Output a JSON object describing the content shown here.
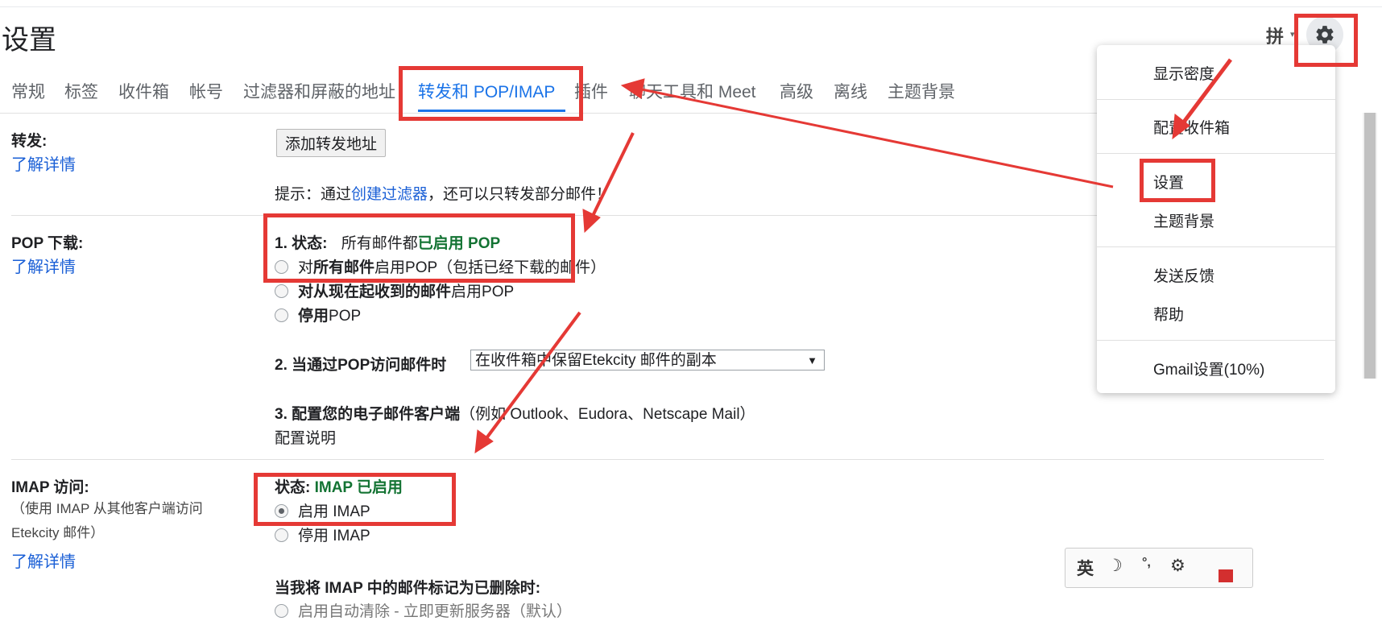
{
  "page": {
    "title": "设置"
  },
  "header": {
    "ime_label": "拼",
    "ime_caret": "▾"
  },
  "tabs": [
    {
      "label": "常规"
    },
    {
      "label": "标签"
    },
    {
      "label": "收件箱"
    },
    {
      "label": "帐号"
    },
    {
      "label": "过滤器和屏蔽的地址"
    },
    {
      "label": "转发和 POP/IMAP",
      "active": true
    },
    {
      "label": "插件"
    },
    {
      "label": "聊天工具和 Meet"
    },
    {
      "label": "高级"
    },
    {
      "label": "离线"
    },
    {
      "label": "主题背景"
    }
  ],
  "forwarding": {
    "label": "转发:",
    "learn_more": "了解详情",
    "add_button": "添加转发地址",
    "tip_prefix": "提示：通过",
    "tip_link": "创建过滤器",
    "tip_suffix": "，还可以只转发部分邮件！"
  },
  "pop": {
    "label": "POP 下载:",
    "learn_more": "了解详情",
    "status_label": "1. 状态:",
    "status_text": "所有邮件都",
    "status_value": "已启用 POP",
    "options": [
      {
        "prefix": "对",
        "bold": "所有邮件",
        "suffix": "启用POP（包括已经下载的邮件）"
      },
      {
        "prefix": "",
        "bold": "对从现在起收到的邮件",
        "suffix": "启用POP"
      },
      {
        "prefix": "",
        "bold": "停用",
        "suffix": "POP"
      }
    ],
    "when_access_label": "2. 当通过POP访问邮件时",
    "when_access_value": "在收件箱中保留Etekcity 邮件的副本",
    "configure_label": "3. 配置您的电子邮件客户端",
    "configure_hint": "（例如 Outlook、Eudora、Netscape Mail）",
    "configure_link": "配置说明"
  },
  "imap": {
    "label": "IMAP 访问:",
    "desc": "（使用 IMAP 从其他客户端访问 Etekcity 邮件）",
    "learn_more": "了解详情",
    "status_label": "状态:",
    "status_value": "IMAP 已启用",
    "options": [
      {
        "label": "启用 IMAP",
        "checked": true
      },
      {
        "label": "停用 IMAP",
        "checked": false
      }
    ],
    "delete_label": "当我将 IMAP 中的邮件标记为已删除时:",
    "delete_option_cutoff": "启用自动清除 - 立即更新服务器（默认）"
  },
  "settings_menu": {
    "items": [
      "显示密度",
      "配置收件箱",
      "设置",
      "主题背景",
      "发送反馈",
      "帮助",
      "Gmail设置(10%)"
    ]
  },
  "ime_widget": {
    "lang": "英",
    "moon": "☽",
    "punct": "°,",
    "gear": "gear-icon"
  },
  "colors": {
    "accent": "#1a73e8",
    "status_green": "#137333",
    "annotation_red": "#e53935",
    "link": "#1a5fd6"
  }
}
